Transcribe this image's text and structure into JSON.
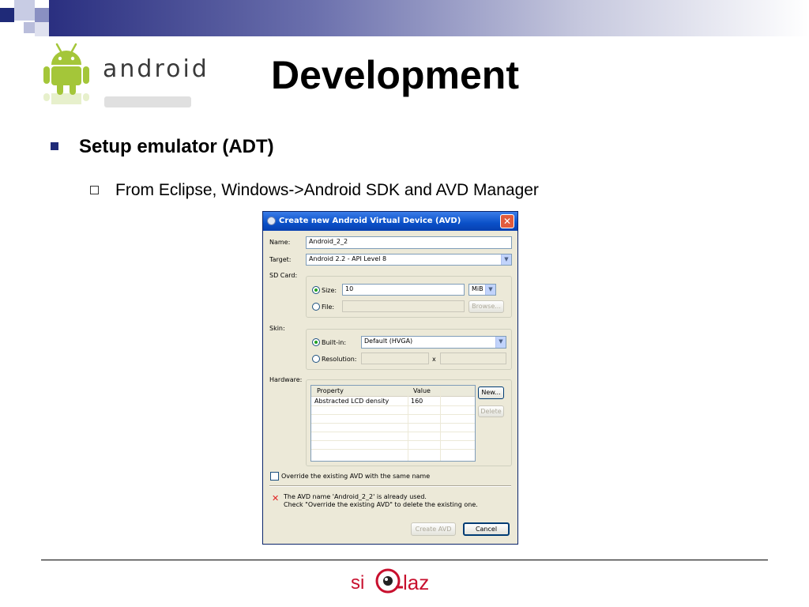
{
  "slide": {
    "title": "Development",
    "bullet1": "Setup emulator (ADT)",
    "bullet2": "From Eclipse, Windows->Android SDK and AVD Manager",
    "logo_word": "android",
    "footer_logo": {
      "left": "si",
      "right": "laz"
    }
  },
  "dialog": {
    "title": "Create new Android Virtual Device (AVD)",
    "name_label": "Name:",
    "name_value": "Android_2_2",
    "target_label": "Target:",
    "target_value": "Android 2.2 - API Level 8",
    "sdcard_label": "SD Card:",
    "size_label": "Size:",
    "size_value": "10",
    "size_unit": "MiB",
    "file_label": "File:",
    "browse_label": "Browse...",
    "skin_label": "Skin:",
    "builtin_label": "Built-in:",
    "builtin_value": "Default (HVGA)",
    "resolution_label": "Resolution:",
    "res_x": "x",
    "hardware_label": "Hardware:",
    "hw_columns": [
      "Property",
      "Value"
    ],
    "hw_rows": [
      {
        "property": "Abstracted LCD density",
        "value": "160"
      }
    ],
    "new_label": "New...",
    "delete_label": "Delete",
    "override_label": "Override the existing AVD with the same name",
    "error_line1": "The AVD name 'Android_2_2' is already used.",
    "error_line2": "Check \"Override the existing AVD\" to delete the existing one.",
    "create_label": "Create AVD",
    "cancel_label": "Cancel"
  },
  "colors": {
    "title_bar": "#0a50c8",
    "dialog_bg": "#ece9d8",
    "error": "#e02020",
    "android_green": "#a4c639",
    "brand_red": "#c8102e",
    "header_blue": "#1f2a78"
  }
}
